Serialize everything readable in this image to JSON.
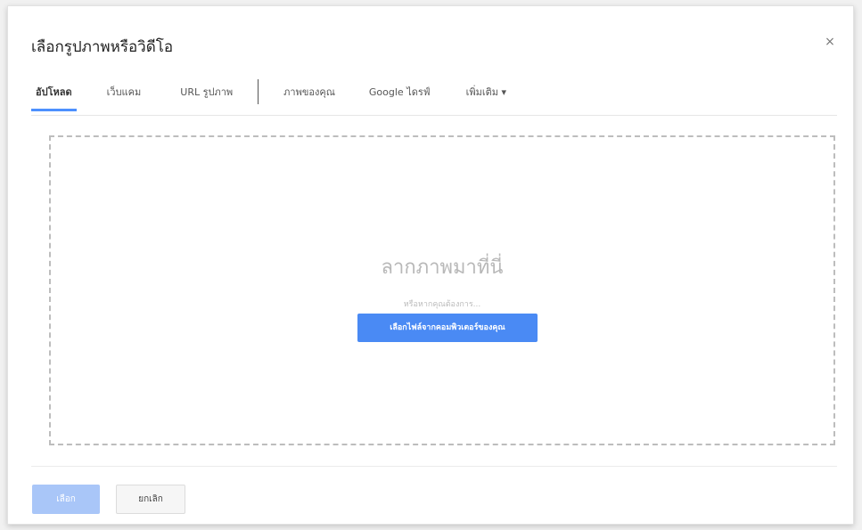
{
  "dialog": {
    "title": "เลือกรูปภาพหรือวิดีโอ",
    "close_glyph": "×"
  },
  "tabs": [
    {
      "label": "อัปโหลด",
      "active": true
    },
    {
      "label": "เว็บแคม",
      "active": false
    },
    {
      "label": "URL รูปภาพ",
      "active": false
    },
    {
      "label": "ภาพของคุณ",
      "active": false
    },
    {
      "label": "Google ไดรฟ์",
      "active": false
    },
    {
      "label": "เพิ่มเติม ▾",
      "active": false
    }
  ],
  "dropzone": {
    "heading": "ลากภาพมาที่นี่",
    "or_text": "หรือหากคุณต้องการ...",
    "button_label": "เลือกไฟล์จากคอมพิวเตอร์ของคุณ"
  },
  "footer": {
    "select_label": "เลือก",
    "cancel_label": "ยกเลิก"
  },
  "colors": {
    "accent": "#4a8af4",
    "accent_disabled": "#a9c6f8",
    "tab_underline": "#4d90fe"
  }
}
